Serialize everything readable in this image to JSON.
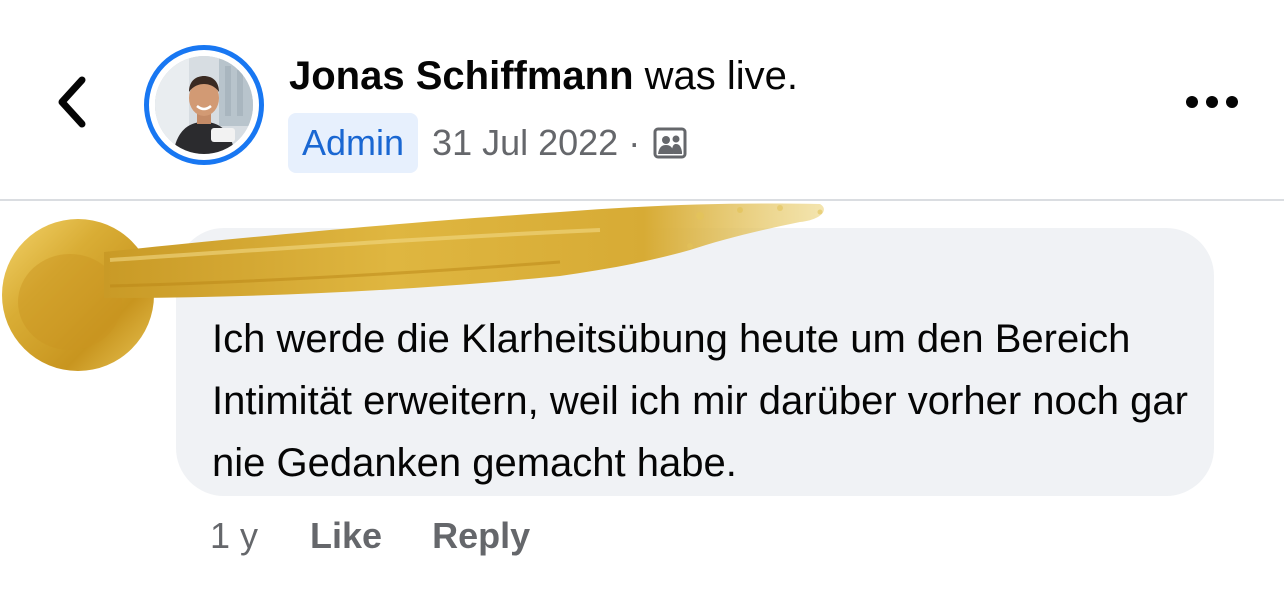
{
  "header": {
    "author_name": "Jonas Schiffmann",
    "action_text": " was live.",
    "role_badge": "Admin",
    "date": "31 Jul 2022",
    "separator": "·",
    "audience_icon": "friends-photo-icon",
    "back_icon": "chevron-left-icon",
    "more_icon": "more-horizontal-icon"
  },
  "comment": {
    "text": "Ich werde die Klarheitsübung heute um den Bereich Intimität erweitern, weil ich mir darüber vorher noch gar nie Gedanken gemacht habe.",
    "time": "1 y",
    "like_label": "Like",
    "reply_label": "Reply"
  },
  "colors": {
    "accent_blue": "#1877f2",
    "admin_text": "#1a67d2",
    "admin_bg": "#e7f0fd",
    "bubble_bg": "#f0f2f5",
    "secondary_text": "#65676b",
    "gold_redaction": "#d4a92e"
  }
}
